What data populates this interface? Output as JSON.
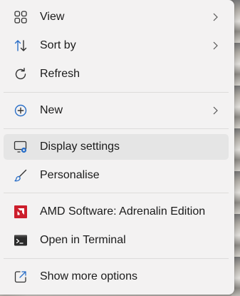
{
  "menu": {
    "items": [
      {
        "id": "view",
        "label": "View",
        "icon": "grid-icon",
        "submenu": true
      },
      {
        "id": "sort-by",
        "label": "Sort by",
        "icon": "sort-arrows-icon",
        "submenu": true
      },
      {
        "id": "refresh",
        "label": "Refresh",
        "icon": "refresh-icon",
        "submenu": false
      },
      {
        "id": "new",
        "label": "New",
        "icon": "plus-circle-icon",
        "submenu": true
      },
      {
        "id": "display-settings",
        "label": "Display settings",
        "icon": "display-settings-icon",
        "submenu": false,
        "highlighted": true
      },
      {
        "id": "personalise",
        "label": "Personalise",
        "icon": "brush-icon",
        "submenu": false
      },
      {
        "id": "amd-software",
        "label": "AMD Software: Adrenalin Edition",
        "icon": "amd-logo-icon",
        "submenu": false
      },
      {
        "id": "open-terminal",
        "label": "Open in Terminal",
        "icon": "terminal-icon",
        "submenu": false
      },
      {
        "id": "show-more",
        "label": "Show more options",
        "icon": "share-out-icon",
        "submenu": false
      }
    ]
  },
  "colors": {
    "menu_background": "#f3f2f2",
    "hover_background": "#e5e5e5",
    "accent_blue": "#2a6fc8",
    "amd_red": "#cc1e2c",
    "text": "#1b1b1b"
  }
}
